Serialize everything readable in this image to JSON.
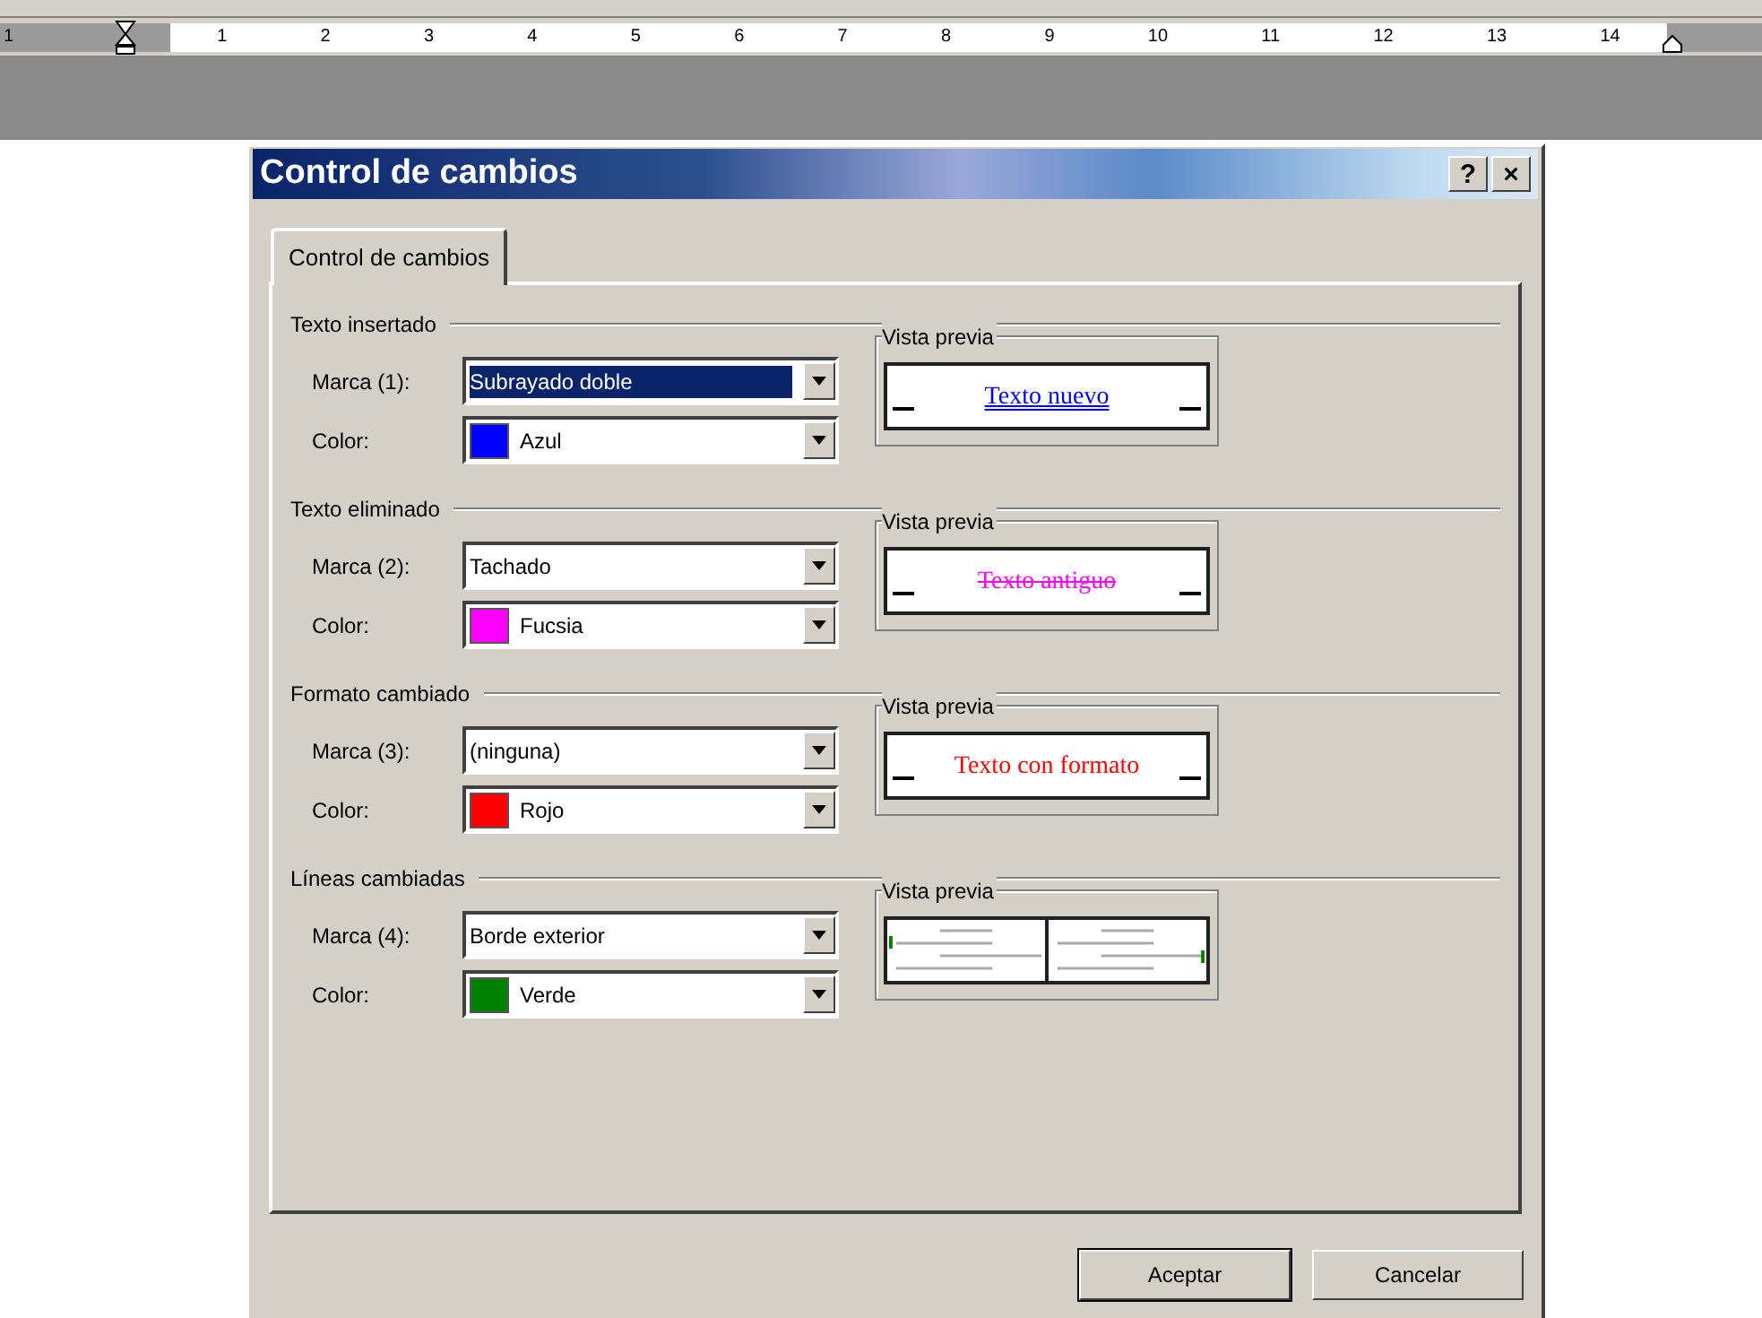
{
  "ruler": {
    "left_numbers": [
      "1"
    ],
    "numbers": [
      "1",
      "2",
      "3",
      "4",
      "5",
      "6",
      "7",
      "8",
      "9",
      "10",
      "11",
      "12",
      "13",
      "14"
    ]
  },
  "dialog": {
    "title": "Control de cambios",
    "help_button": "?",
    "close_button": "×",
    "tabs": [
      {
        "label": "Control de cambios",
        "selected": true
      }
    ],
    "sections": [
      {
        "title": "Texto insertado",
        "mark_label": "Marca (1):",
        "mark_value": "Subrayado doble",
        "mark_focused": true,
        "color_label": "Color:",
        "color_value": "Azul",
        "color": "#0000ff",
        "preview_title": "Vista previa",
        "preview": {
          "kind": "double-underline",
          "text": "Texto nuevo"
        }
      },
      {
        "title": "Texto eliminado",
        "mark_label": "Marca (2):",
        "mark_value": "Tachado",
        "mark_focused": false,
        "color_label": "Color:",
        "color_value": "Fucsia",
        "color": "#ff00ff",
        "preview_title": "Vista previa",
        "preview": {
          "kind": "strikethrough",
          "text": "Texto antiguo"
        }
      },
      {
        "title": "Formato cambiado",
        "mark_label": "Marca (3):",
        "mark_value": "(ninguna)",
        "mark_focused": false,
        "color_label": "Color:",
        "color_value": "Rojo",
        "color": "#ff0000",
        "preview_title": "Vista previa",
        "preview": {
          "kind": "plain",
          "text": "Texto con formato"
        }
      },
      {
        "title": "Líneas cambiadas",
        "mark_label": "Marca (4):",
        "mark_value": "Borde exterior",
        "mark_focused": false,
        "color_label": "Color:",
        "color_value": "Verde",
        "color": "#008000",
        "preview_title": "Vista previa",
        "preview": {
          "kind": "lines"
        }
      }
    ],
    "buttons": [
      {
        "label": "Aceptar",
        "default": true
      },
      {
        "label": "Cancelar",
        "default": false
      }
    ]
  }
}
